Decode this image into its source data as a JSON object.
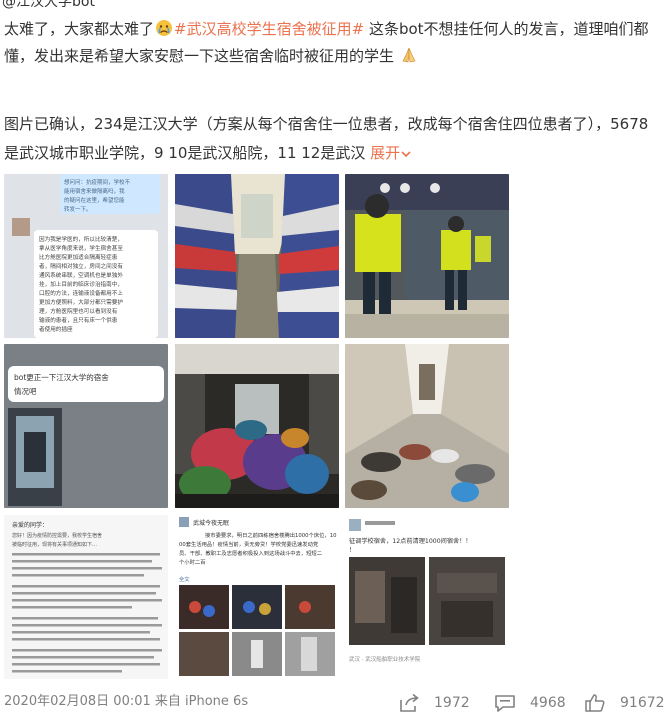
{
  "post": {
    "para1_start": "太难了，大家都太难了",
    "hashtag": "#武汉高校学生宿舍被征用#",
    "para1_mid": "这条bot不想挂任何人的发言，道理咱们都懂，发出来是希望大家安慰一下这些宿舍临时被征用的学生",
    "para2": "图片已确认，234是江汉大学（方案从每个宿舍住一位患者，改成每个宿舍住四位患者了），5678是武汉城市职业学院，9 10是武汉船院，11 12是武汉",
    "expand_label": "展开"
  },
  "images": {
    "img1": {
      "line1": "想问问：抗疫期间，学校不",
      "line2": "能用宿舍来做隔离吗，我",
      "line3": "的疑问在这里，希望您能",
      "line4": "转发一下。",
      "reply_lines": [
        "因为我是学医的，所以比较清楚，",
        "拿从医学角度来说，学生宿舍甚至",
        "比方舱医院更加适合隔离轻症患",
        "者，隔间相对独立，房间之间没有",
        "通风系统串联，空调机也是单独外",
        "挂，加上目前的临床诊治指南中，",
        "口腔的方法，连输液设备都用不上",
        "更加方便照料，大部分都只需要护",
        "理，方舱医院里也可以看到没有",
        "输液的患者，且只有床一个供患",
        "者使用的插座"
      ]
    },
    "img4": {
      "caption": "bot更正一下江汉大学的宿舍情况吧"
    },
    "img7": {
      "lines": [
        "亲爱的同学：",
        "您好！因为疫情防控需要，我校学生宿舍",
        "被临时征用，现将有关事项通知如下…"
      ]
    },
    "img8": {
      "header": "武城今夜无眠",
      "caption": "接市委要求，明日之前四栋宿舍楼腾出1000个床位，1000套生活用品！疫情当前，责无旁贷！学校党委迅速发动党员、干部、教职工及志愿者积极投入到这场战斗中去，短短二个小时二百",
      "sub": "全文"
    },
    "img9": {
      "caption": "征调学校宿舍，12点前清理1000间宿舍！！！",
      "footer": "武汉 · 武汉船舶职业技术学院"
    }
  },
  "footer": {
    "timestamp": "2020年02月08日 00:01 来自 iPhone 6s",
    "share_count": "1972",
    "comment_count": "4968",
    "like_count": "91672"
  },
  "colors": {
    "hashtag": "#eb7350",
    "meta_text": "#808080",
    "body_text": "#333333"
  },
  "icons": {
    "emoji_cry": "crying-face",
    "emoji_pray": "folded-hands",
    "share": "share-arrow-icon",
    "comment": "comment-bubble-icon",
    "like": "thumbs-up-icon",
    "chevron": "chevron-down-icon"
  }
}
